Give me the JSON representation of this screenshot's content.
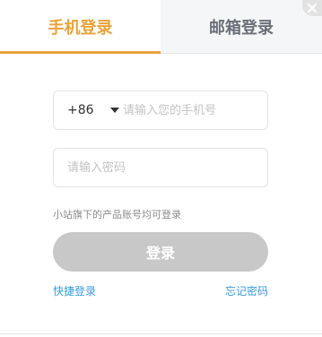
{
  "tabs": {
    "phone_label": "手机登录",
    "email_label": "邮箱登录"
  },
  "close": {
    "icon": "close-icon"
  },
  "phone_field": {
    "country_code": "+86",
    "placeholder": "请输入您的手机号",
    "value": ""
  },
  "password_field": {
    "placeholder": "请输入密码",
    "value": ""
  },
  "hint_text": "小站旗下的产品账号均可登录",
  "login_button": "登录",
  "links": {
    "quick_login": "快捷登录",
    "forgot_password": "忘记密码"
  },
  "colors": {
    "accent": "#e8a33a",
    "link": "#3a9ad9",
    "button_disabled": "#c8c8c8"
  }
}
